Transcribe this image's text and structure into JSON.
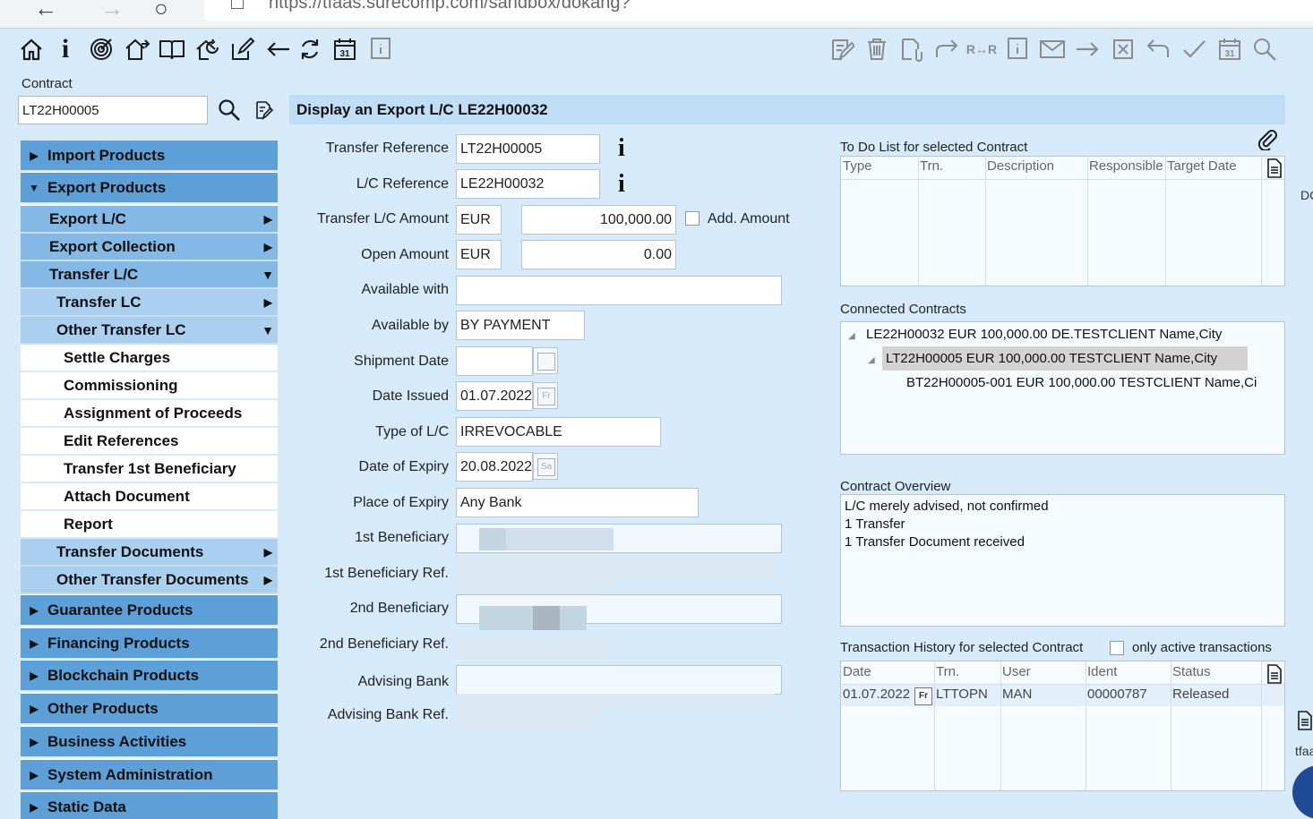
{
  "browser": {
    "url": "https://tfaas.surecomp.com/sandbox/dokang?"
  },
  "contract_search": {
    "label": "Contract",
    "value": "LT22H00005"
  },
  "sidebar": {
    "items": [
      {
        "label": "Import Products"
      },
      {
        "label": "Export Products"
      },
      {
        "label": "Export L/C"
      },
      {
        "label": "Export Collection"
      },
      {
        "label": "Transfer L/C"
      },
      {
        "label": "Transfer LC"
      },
      {
        "label": "Other Transfer LC"
      },
      {
        "label": "Settle Charges"
      },
      {
        "label": "Commissioning"
      },
      {
        "label": "Assignment of Proceeds"
      },
      {
        "label": "Edit References"
      },
      {
        "label": "Transfer 1st Beneficiary"
      },
      {
        "label": "Attach Document"
      },
      {
        "label": "Report"
      },
      {
        "label": "Transfer Documents"
      },
      {
        "label": "Other Transfer Documents"
      },
      {
        "label": "Guarantee Products"
      },
      {
        "label": "Financing Products"
      },
      {
        "label": "Blockchain Products"
      },
      {
        "label": "Other Products"
      },
      {
        "label": "Business Activities"
      },
      {
        "label": "System Administration"
      },
      {
        "label": "Static Data"
      }
    ]
  },
  "content": {
    "title": "Display an Export L/C LE22H00032"
  },
  "form": {
    "transfer_reference": {
      "label": "Transfer Reference",
      "value": "LT22H00005"
    },
    "lc_reference": {
      "label": "L/C Reference",
      "value": "LE22H00032"
    },
    "transfer_amount": {
      "label": "Transfer L/C Amount",
      "currency": "EUR",
      "value": "100,000.00",
      "add_amount_label": "Add. Amount"
    },
    "open_amount": {
      "label": "Open Amount",
      "currency": "EUR",
      "value": "0.00"
    },
    "available_with": {
      "label": "Available with",
      "value": ""
    },
    "available_by": {
      "label": "Available by",
      "value": "BY PAYMENT"
    },
    "shipment_date": {
      "label": "Shipment Date",
      "value": ""
    },
    "date_issued": {
      "label": "Date Issued",
      "value": "01.07.2022",
      "day_abbr": "Fr"
    },
    "type_of_lc": {
      "label": "Type of L/C",
      "value": "IRREVOCABLE"
    },
    "date_of_expiry": {
      "label": "Date of Expiry",
      "value": "20.08.2022",
      "day_abbr": "Sa"
    },
    "place_of_expiry": {
      "label": "Place of Expiry",
      "value": "Any Bank"
    },
    "first_beneficiary": {
      "label": "1st Beneficiary"
    },
    "first_beneficiary_ref": {
      "label": "1st Beneficiary Ref."
    },
    "second_beneficiary": {
      "label": "2nd Beneficiary"
    },
    "second_beneficiary_ref": {
      "label": "2nd Beneficiary Ref."
    },
    "advising_bank": {
      "label": "Advising Bank"
    },
    "advising_bank_ref": {
      "label": "Advising Bank Ref."
    }
  },
  "todo": {
    "title": "To Do List for selected Contract",
    "columns": [
      "Type",
      "Trn.",
      "Description",
      "Responsible",
      "Target Date"
    ]
  },
  "connected": {
    "title": "Connected Contracts",
    "rows": [
      "LE22H00032 EUR 100,000.00 DE.TESTCLIENT Name,City",
      "LT22H00005 EUR 100,000.00 TESTCLIENT Name,City",
      "BT22H00005-001 EUR 100,000.00 TESTCLIENT Name,Ci"
    ]
  },
  "overview": {
    "title": "Contract Overview",
    "lines": [
      "L/C merely advised, not confirmed",
      "1 Transfer",
      "1 Transfer Document received"
    ]
  },
  "history": {
    "title": "Transaction History for selected Contract",
    "only_active_label": "only active transactions",
    "columns": [
      "Date",
      "Trn.",
      "User",
      "Ident",
      "Status"
    ],
    "rows": [
      {
        "date": "01.07.2022",
        "day_abbr": "Fr",
        "trn": "LTTOPN",
        "user": "MAN",
        "ident": "00000787",
        "status": "Released"
      }
    ]
  },
  "edge": {
    "right_top": "DC",
    "right_bottom": "tfaa"
  }
}
